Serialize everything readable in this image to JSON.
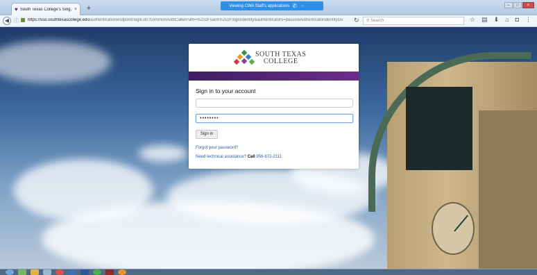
{
  "browser": {
    "tab_title": "South Texas College's Sing...",
    "tab_close": "×",
    "new_tab": "+",
    "sharing_banner": "Viewing CWA Staff's applications",
    "url_host": "https://sso.southtexascollege.edu",
    "url_path": "/authenticationendpoint/login.do?commonAuthCallerPath=%252Fsaml%252FloginIdentity&authenticators=passiveAuthenticatorIdentityDo",
    "search_placeholder": "Search",
    "window_controls": [
      "–",
      "□",
      "×"
    ]
  },
  "login": {
    "logo_line1": "SOUTH TEXAS",
    "logo_line2": "COLLEGE",
    "heading": "Sign in to your account",
    "username_value": "",
    "password_value": "••••••••",
    "signin_label": "Sign in",
    "forgot_link": "Forgot your password?",
    "help_prefix": "Need technical assistance?",
    "help_call": "Call",
    "help_phone": "956-872-2111"
  },
  "colors": {
    "brand_purple": "#5a2780",
    "banner_blue": "#2f8ee6"
  },
  "icons": [
    "back-icon",
    "lock-icon",
    "reload-icon",
    "bookmark-star-icon",
    "clipboard-icon",
    "download-icon",
    "home-icon",
    "pocket-icon",
    "menu-icon"
  ]
}
